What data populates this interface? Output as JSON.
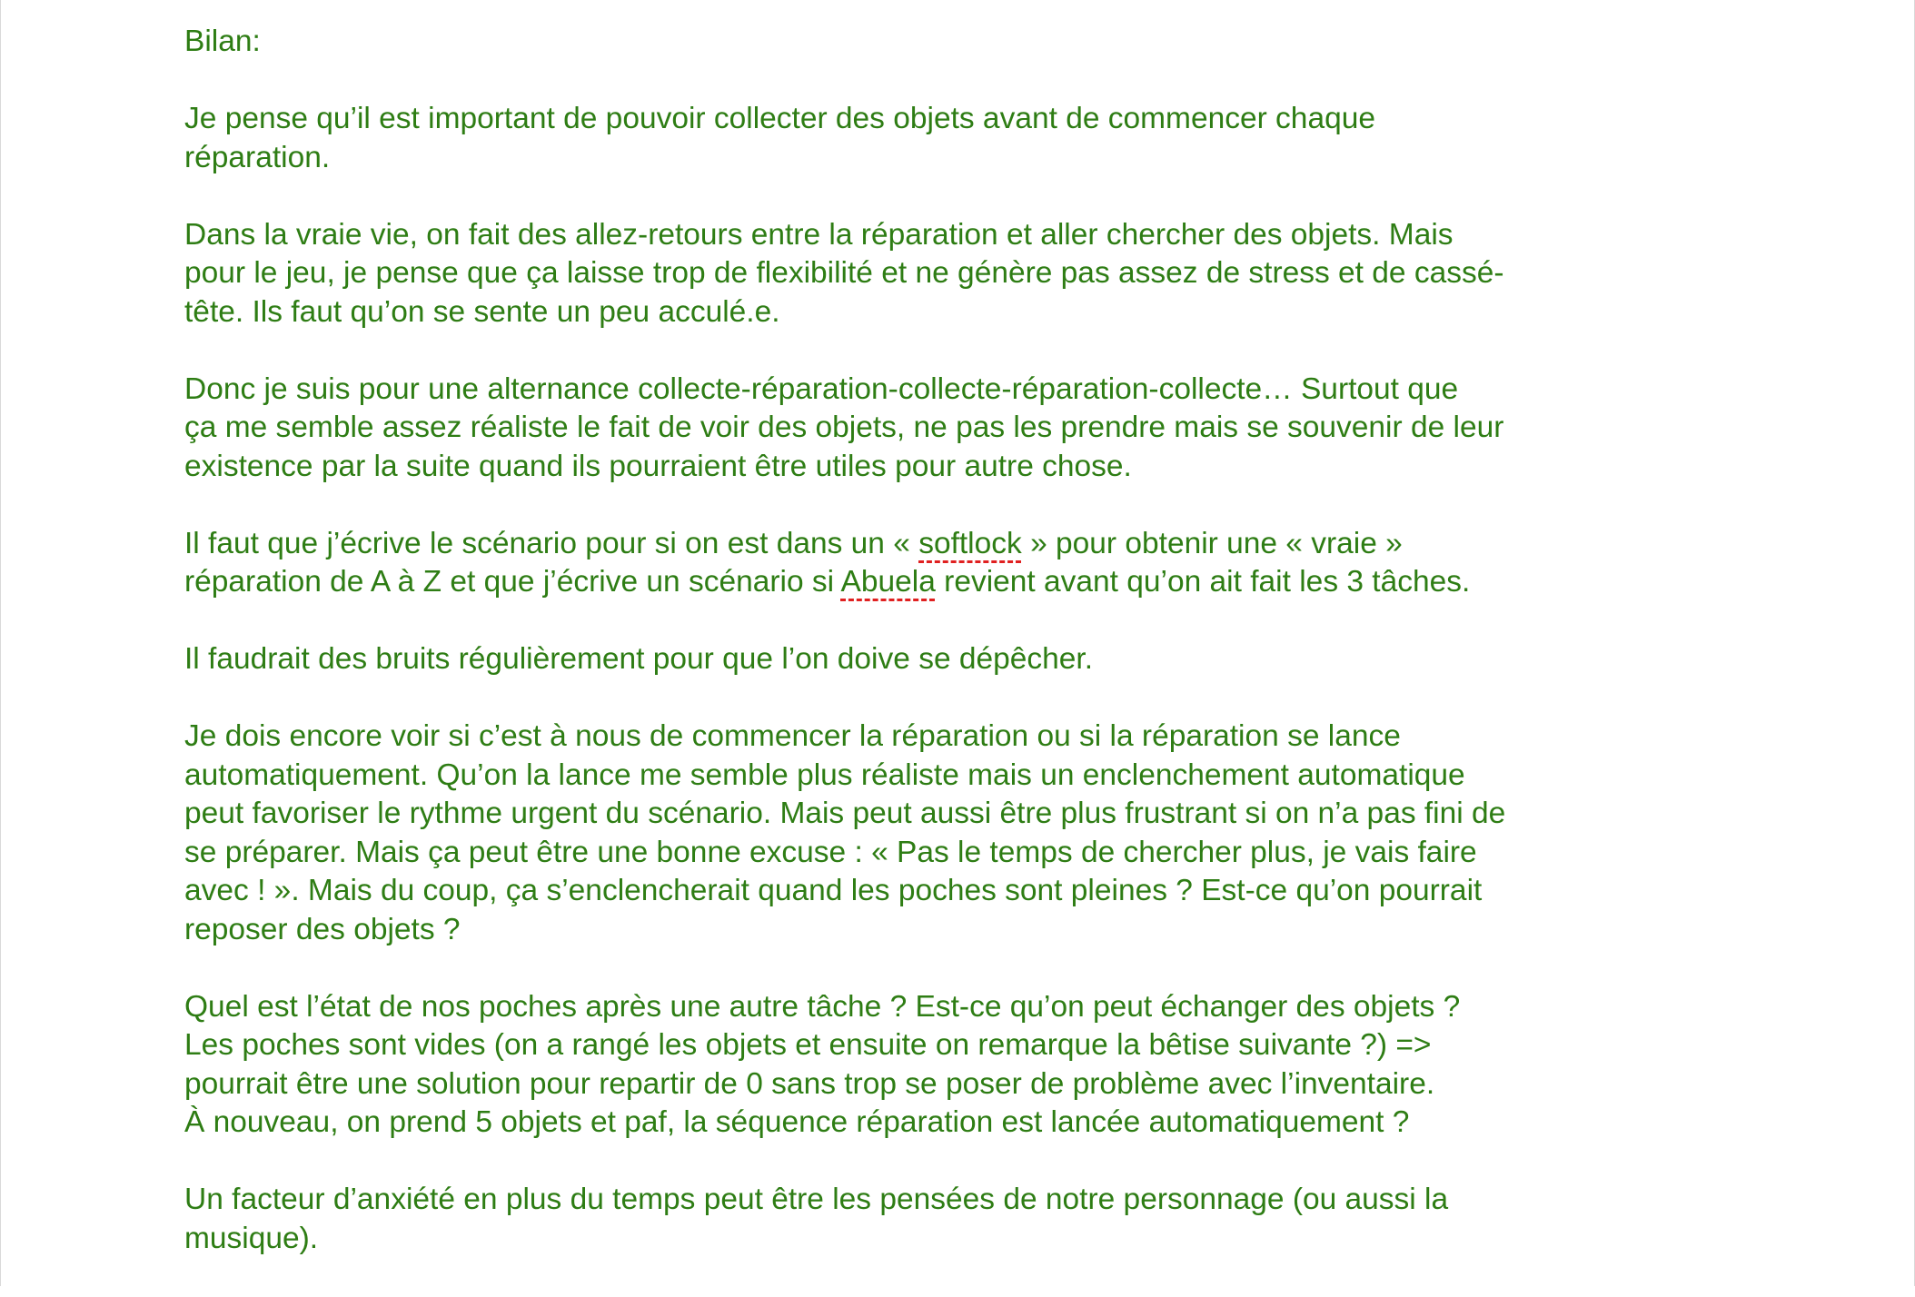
{
  "title": "Bilan:",
  "paragraphs": [
    {
      "lines": [
        "Je pense qu’il est important de pouvoir collecter des objets avant de commencer chaque",
        "réparation."
      ]
    },
    {
      "lines": [
        "Dans la vraie vie, on fait des allez-retours entre la réparation et aller chercher des objets. Mais",
        "pour le jeu, je pense que ça laisse trop de flexibilité et ne génère pas assez de stress et de cassé-",
        "tête. Ils faut qu’on se sente un peu acculé.e."
      ]
    },
    {
      "lines": [
        "Donc je suis pour une alternance collecte-réparation-collecte-réparation-collecte… Surtout que",
        "ça me semble assez réaliste le fait de voir des objets, ne pas les prendre mais se souvenir de leur",
        "existence par la suite quand ils pourraient être utiles pour autre chose."
      ]
    },
    {
      "line1_before": "Il faut que j’écrive le scénario pour si on est dans un « ",
      "line1_flagged": "softlock",
      "line1_after": " » pour obtenir une « vraie »",
      "line2_before": "réparation de A à Z et que j’écrive un scénario si ",
      "line2_flagged": "Abuela",
      "line2_after": " revient avant qu’on ait fait les 3 tâches."
    },
    {
      "lines": [
        "Il faudrait des bruits régulièrement pour que l’on doive se dépêcher."
      ]
    },
    {
      "lines": [
        "Je dois encore voir si c’est à nous de commencer la réparation ou si la réparation se lance",
        "automatiquement. Qu’on la lance me semble plus réaliste mais un enclenchement automatique",
        "peut favoriser le rythme urgent du scénario. Mais peut aussi être plus frustrant si on n’a pas fini de",
        "se préparer. Mais ça peut être une bonne excuse : « Pas le temps de chercher plus, je vais faire",
        "avec ! ». Mais du coup, ça s’enclencherait quand les poches sont pleines ? Est-ce qu’on pourrait",
        "reposer des objets ?"
      ]
    },
    {
      "lines": [
        "Quel est l’état de nos poches après une autre tâche ? Est-ce qu’on peut échanger des objets ?",
        "Les poches sont vides (on a rangé les objets et ensuite on remarque la bêtise suivante ?) =>",
        "pourrait être une solution pour repartir de 0 sans trop se poser de problème avec l’inventaire.",
        "À nouveau, on prend 5 objets et paf, la séquence réparation est lancée automatiquement ?"
      ]
    },
    {
      "lines": [
        "Un facteur d’anxiété en plus du temps peut être les pensées de notre personnage (ou aussi la",
        "musique)."
      ]
    }
  ],
  "colors": {
    "text": "#2e7d14",
    "spellcheck_underline": "#e02020",
    "background": "#ffffff"
  }
}
